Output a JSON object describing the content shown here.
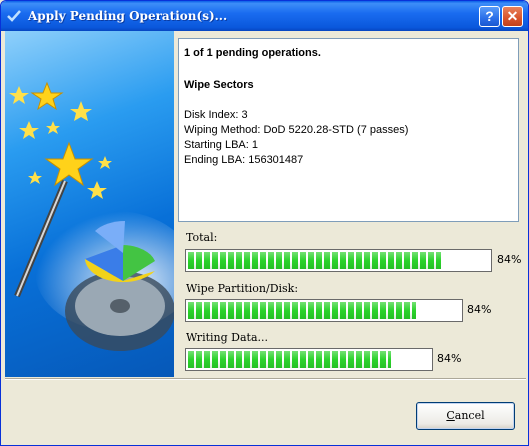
{
  "window": {
    "title": "Apply Pending Operation(s)...",
    "help_label": "?",
    "close_label": "✕"
  },
  "info": {
    "summary": "1 of 1 pending operations.",
    "operation": "Wipe Sectors",
    "details": [
      "Disk Index: 3",
      "Wiping Method: DoD 5220.28-STD (7 passes)",
      "Starting LBA: 1",
      "Ending LBA: 156301487"
    ]
  },
  "progress": [
    {
      "label": "Total:",
      "percent_text": "84%",
      "fraction": 0.84
    },
    {
      "label": "Wipe Partition/Disk:",
      "percent_text": "84%",
      "fraction": 0.84
    },
    {
      "label": "Writing Data...",
      "percent_text": "84%",
      "fraction": 0.84
    }
  ],
  "buttons": {
    "cancel_prefix": "",
    "cancel_underlined": "C",
    "cancel_rest": "ancel"
  },
  "colors": {
    "progress_fill": "#2bd22b",
    "titlebar": "#0a58dc"
  }
}
